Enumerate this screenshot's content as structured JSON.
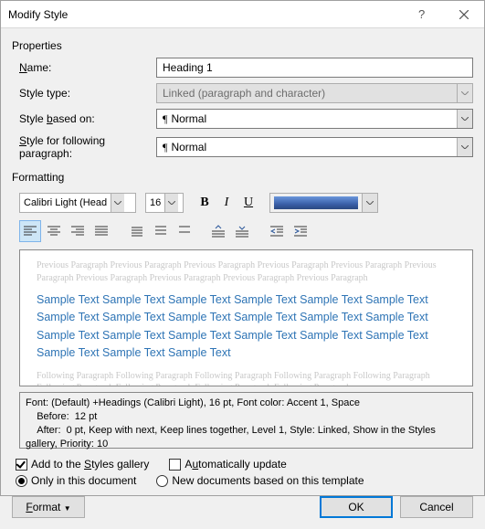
{
  "titlebar": {
    "title": "Modify Style"
  },
  "section": {
    "properties": "Properties",
    "formatting": "Formatting"
  },
  "fields": {
    "name": {
      "label_pre": "",
      "u": "N",
      "label_post": "ame:",
      "value": "Heading 1"
    },
    "styletype": {
      "label": "Style type:",
      "value": "Linked (paragraph and character)"
    },
    "basedon": {
      "label_pre": "Style ",
      "u": "b",
      "label_post": "ased on:",
      "value": "Normal"
    },
    "following": {
      "label_pre": "",
      "u": "S",
      "label_post": "tyle for following paragraph:",
      "value": "Normal"
    }
  },
  "toolbar": {
    "font": "Calibri Light (Head",
    "size": "16"
  },
  "preview": {
    "grey_before": "Previous Paragraph Previous Paragraph Previous Paragraph Previous Paragraph Previous Paragraph Previous Paragraph Previous Paragraph Previous Paragraph Previous Paragraph Previous Paragraph",
    "sample": "Sample Text Sample Text Sample Text Sample Text Sample Text Sample Text Sample Text Sample Text Sample Text Sample Text Sample Text Sample Text Sample Text Sample Text Sample Text Sample Text Sample Text Sample Text Sample Text Sample Text Sample Text",
    "grey_after": "Following Paragraph Following Paragraph Following Paragraph Following Paragraph Following Paragraph Following Paragraph Following Paragraph Following Paragraph Following Paragraph"
  },
  "description": {
    "l1": "Font: (Default) +Headings (Calibri Light), 16 pt, Font color: Accent 1, Space",
    "l2": "    Before:  12 pt",
    "l3": "    After:  0 pt, Keep with next, Keep lines together, Level 1, Style: Linked, Show in the Styles gallery, Priority: 10"
  },
  "options": {
    "add_gallery": {
      "pre": "Add to the ",
      "u": "S",
      "post": "tyles gallery"
    },
    "auto_update": {
      "pre": "A",
      "u": "u",
      "post": "tomatically update"
    },
    "only_doc": "Only in this document",
    "new_template": "New documents based on this template"
  },
  "buttons": {
    "format": "Format",
    "ok": "OK",
    "cancel": "Cancel"
  }
}
